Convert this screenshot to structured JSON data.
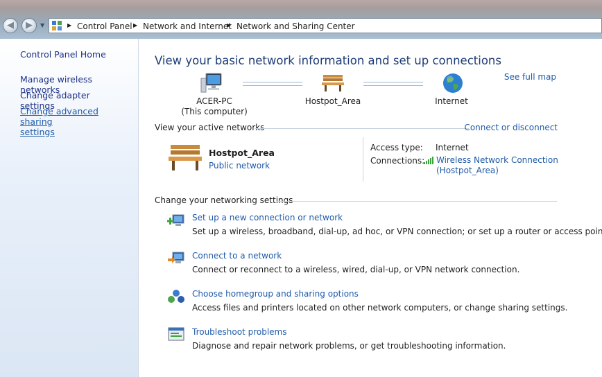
{
  "address_bar": {
    "breadcrumbs": [
      "Control Panel",
      "Network and Internet",
      "Network and Sharing Center"
    ]
  },
  "sidebar": {
    "home": "Control Panel Home",
    "links": [
      "Manage wireless networks",
      "Change adapter settings",
      "Change advanced sharing",
      "settings"
    ]
  },
  "main": {
    "title": "View your basic network information and set up connections",
    "see_full_map": "See full map",
    "map": {
      "computer_name": "ACER-PC",
      "computer_sub": "(This computer)",
      "network_name": "Hostpot_Area",
      "internet": "Internet"
    },
    "active_networks": {
      "heading": "View your active networks",
      "connect_link": "Connect or disconnect",
      "network_name": "Hostpot_Area",
      "network_type": "Public network",
      "access_type_label": "Access type:",
      "access_type_value": "Internet",
      "connections_label": "Connections:",
      "connection_line1": "Wireless Network Connection",
      "connection_line2": "(Hostpot_Area)"
    },
    "settings": {
      "heading": "Change your networking settings",
      "tasks": [
        {
          "link": "Set up a new connection or network",
          "desc": "Set up a wireless, broadband, dial-up, ad hoc, or VPN connection; or set up a router or access point."
        },
        {
          "link": "Connect to a network",
          "desc": "Connect or reconnect to a wireless, wired, dial-up, or VPN network connection."
        },
        {
          "link": "Choose homegroup and sharing options",
          "desc": "Access files and printers located on other network computers, or change sharing settings."
        },
        {
          "link": "Troubleshoot problems",
          "desc": "Diagnose and repair network problems, or get troubleshooting information."
        }
      ]
    }
  },
  "colors": {
    "link": "#1f5aa8",
    "title": "#1e3c78",
    "sidebar_link": "#1e3287"
  }
}
